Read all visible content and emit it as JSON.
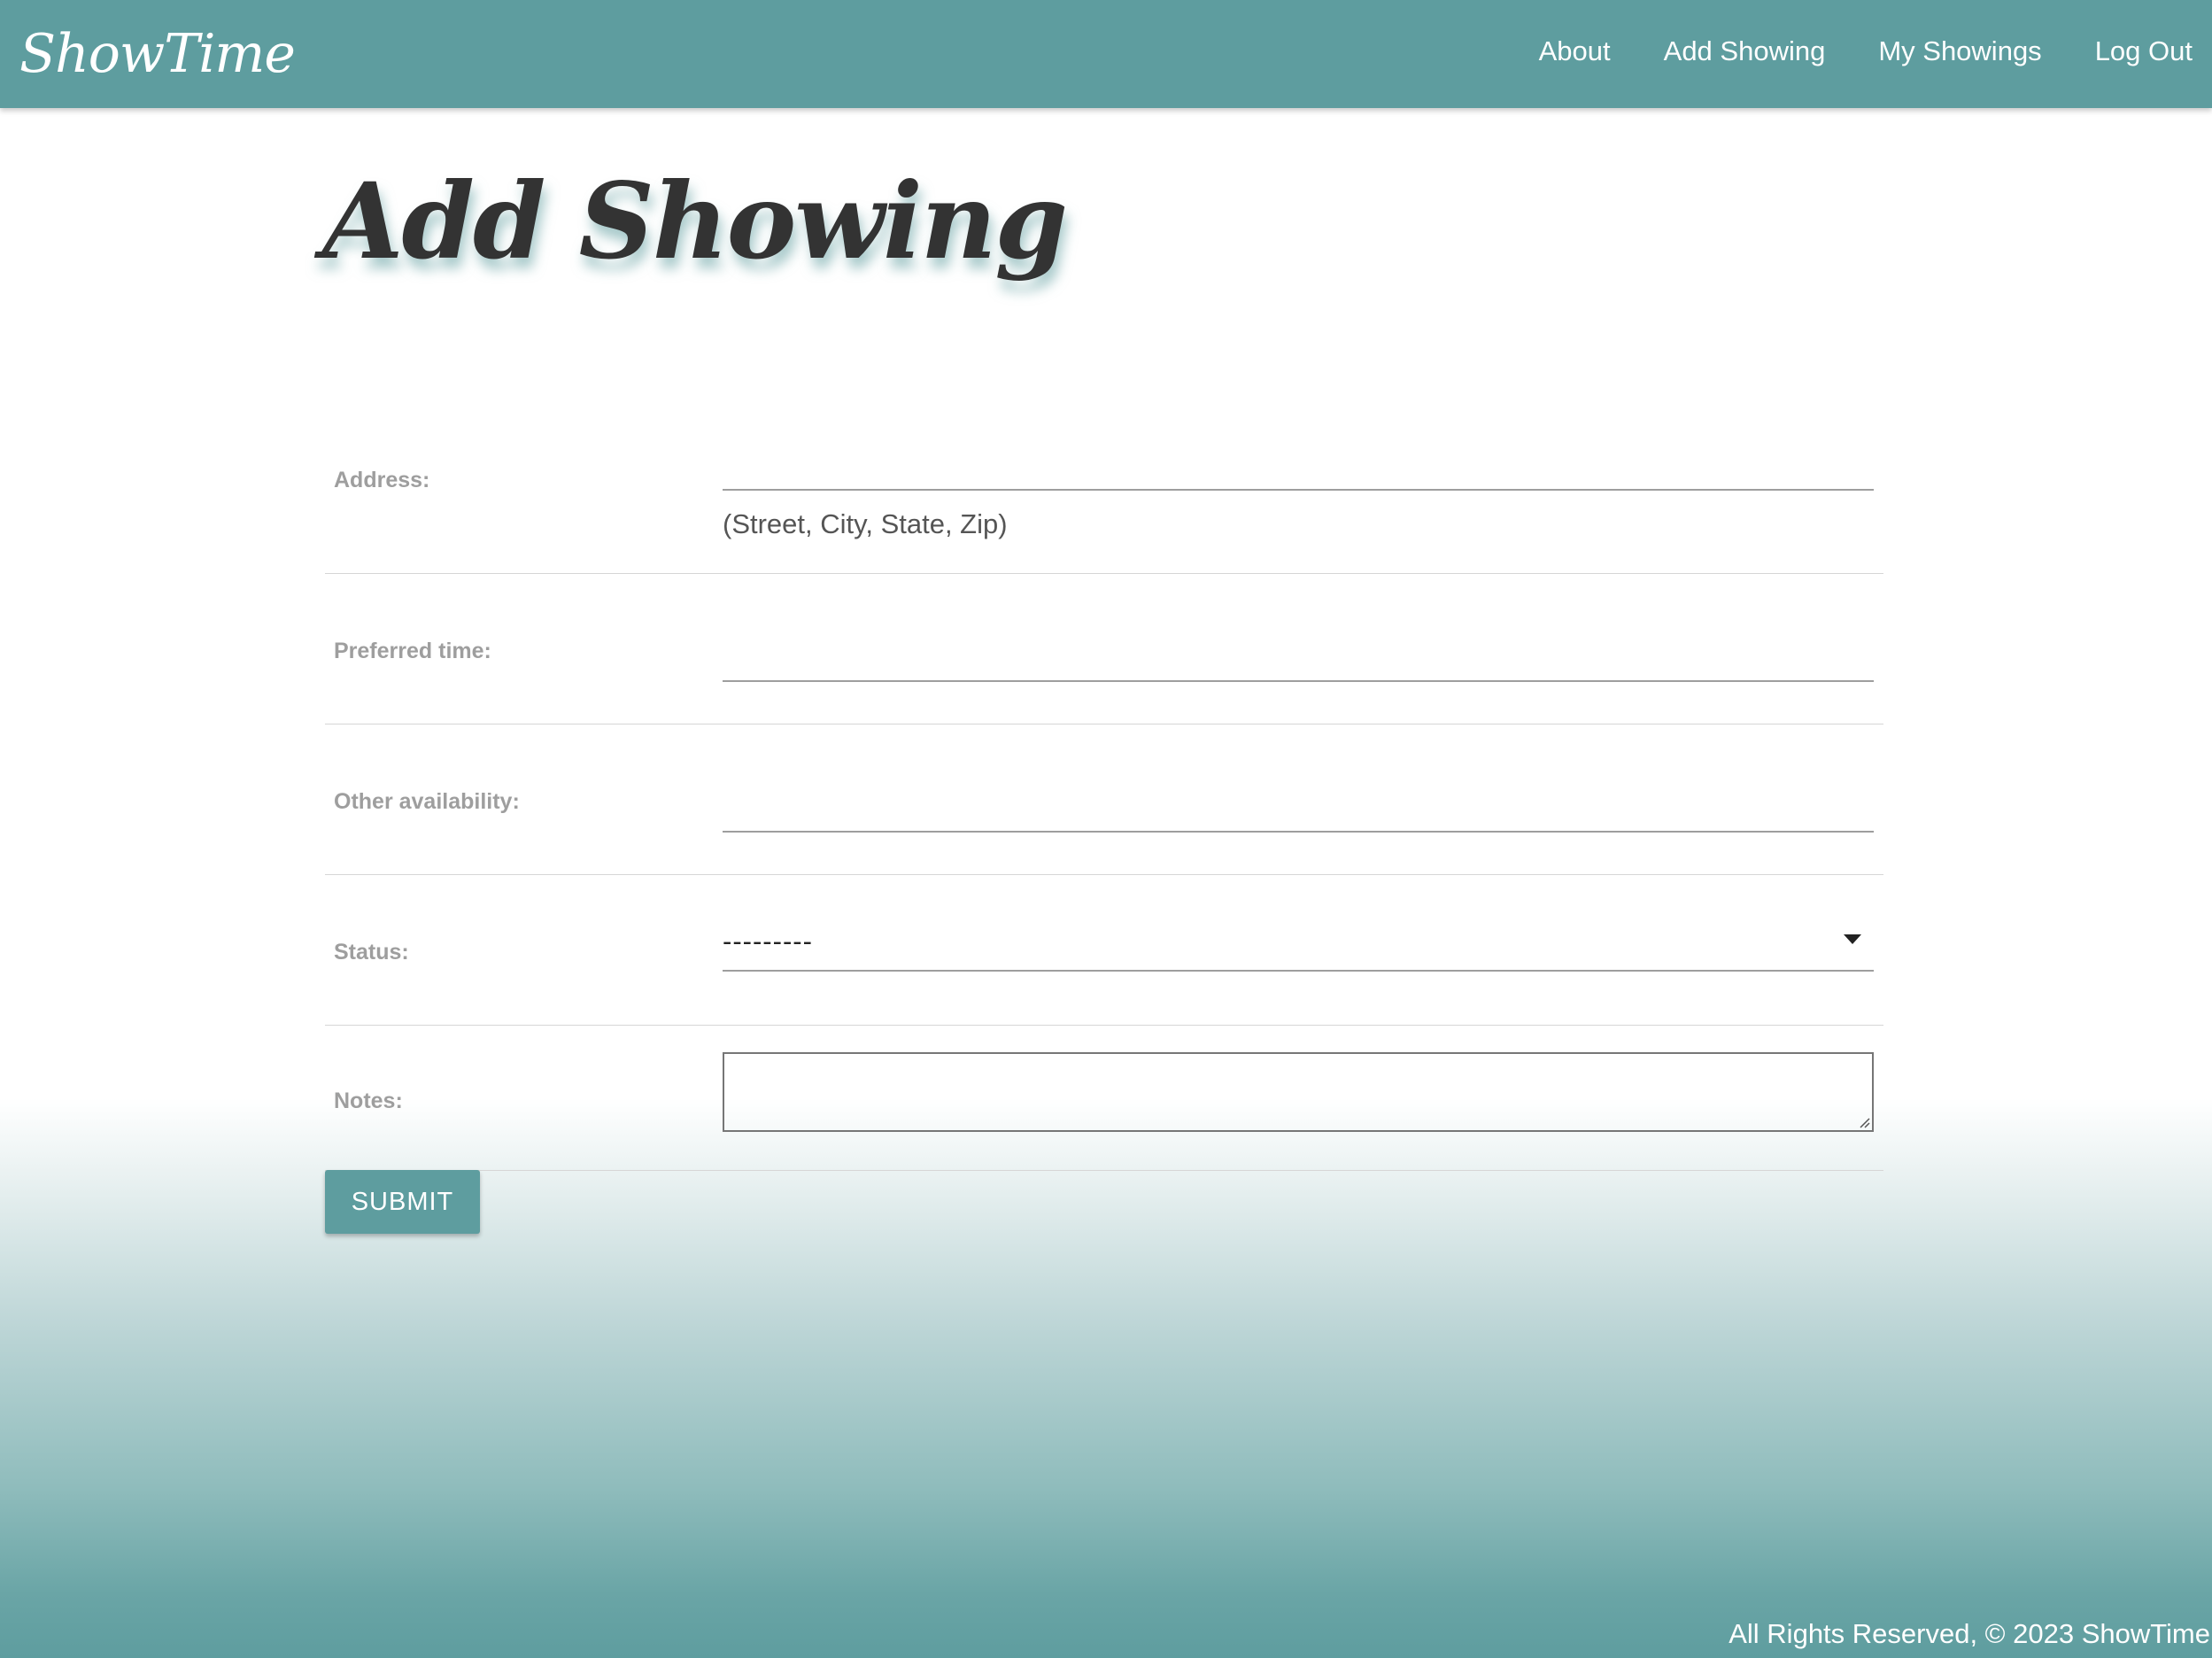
{
  "navbar": {
    "brand": "ShowTime",
    "links": [
      "About",
      "Add Showing",
      "My Showings",
      "Log Out"
    ]
  },
  "page": {
    "title": "Add Showing"
  },
  "form": {
    "address": {
      "label": "Address:",
      "value": "",
      "helptext": "(Street, City, State, Zip)"
    },
    "preferred_time": {
      "label": "Preferred time:",
      "value": ""
    },
    "other_availability": {
      "label": "Other availability:",
      "value": ""
    },
    "status": {
      "label": "Status:",
      "selected": "---------"
    },
    "notes": {
      "label": "Notes:",
      "value": ""
    },
    "submit_label": "SUBMIT"
  },
  "footer": {
    "text": "All Rights Reserved, © 2023 ShowTime"
  },
  "colors": {
    "primary": "#5e9d9f",
    "heading": "#333333",
    "label": "#9e9e9e"
  }
}
